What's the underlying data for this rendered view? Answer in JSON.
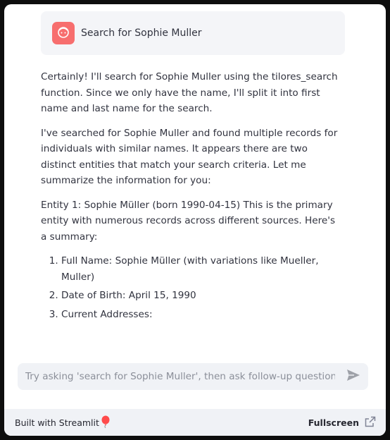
{
  "user_message": {
    "text": "Search for Sophie Muller",
    "avatar_icon": "face-icon",
    "avatar_color": "#f76e6e"
  },
  "assistant": {
    "paragraphs": [
      "Certainly! I'll search for Sophie Muller using the tilores_search function. Since we only have the name, I'll split it into first name and last name for the search.",
      "I've searched for Sophie Muller and found multiple records for individuals with similar names. It appears there are two distinct entities that match your search criteria. Let me summarize the information for you:",
      "Entity 1: Sophie Müller (born 1990-04-15) This is the primary entity with numerous records across different sources. Here's a summary:"
    ],
    "list": [
      "Full Name: Sophie Müller (with variations like Mueller, Muller)",
      "Date of Birth: April 15, 1990",
      "Current Addresses:"
    ]
  },
  "chat_input": {
    "placeholder": "Try asking 'search for Sophie Muller', then ask follow-up questions",
    "send_icon": "send-icon"
  },
  "footer": {
    "built_with": "Built with Streamlit",
    "balloon_icon": "balloon-icon",
    "fullscreen_label": "Fullscreen",
    "fullscreen_icon": "open-external-icon"
  }
}
